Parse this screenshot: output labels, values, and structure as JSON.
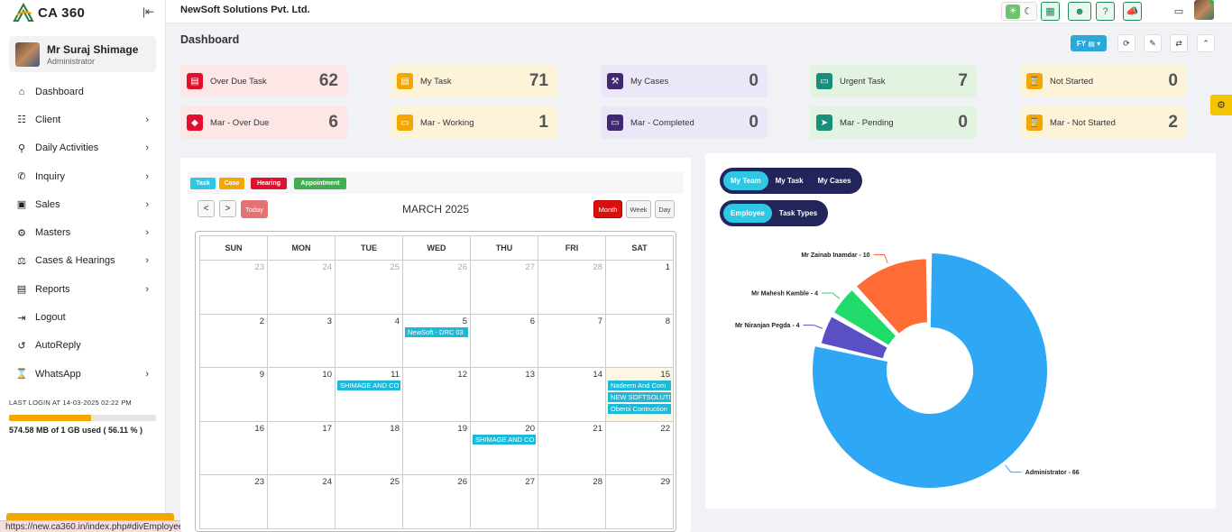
{
  "app": {
    "logo_text": "CA 360",
    "company": "NewSoft Solutions Pvt. Ltd."
  },
  "user": {
    "name": "Mr Suraj Shimage",
    "role": "Administrator"
  },
  "sidebar": {
    "items": [
      {
        "label": "Dashboard",
        "icon": "home-icon",
        "chevron": false
      },
      {
        "label": "Client",
        "icon": "users-icon",
        "chevron": true
      },
      {
        "label": "Daily Activities",
        "icon": "pin-icon",
        "chevron": true
      },
      {
        "label": "Inquiry",
        "icon": "phone-icon",
        "chevron": true
      },
      {
        "label": "Sales",
        "icon": "cash-icon",
        "chevron": true
      },
      {
        "label": "Masters",
        "icon": "gears-icon",
        "chevron": true
      },
      {
        "label": "Cases & Hearings",
        "icon": "scale-icon",
        "chevron": true
      },
      {
        "label": "Reports",
        "icon": "document-icon",
        "chevron": true
      },
      {
        "label": "Logout",
        "icon": "logout-icon",
        "chevron": false
      },
      {
        "label": "AutoReply",
        "icon": "reply-icon",
        "chevron": false
      },
      {
        "label": "WhatsApp",
        "icon": "hourglass-icon",
        "chevron": true
      }
    ],
    "last_login": "LAST LOGIN AT 14-03-2025 02:22 PM",
    "storage_text": "574.58 MB of 1 GB used ( 56.11 % )",
    "storage_pct": 56.11
  },
  "status_url": "https://new.ca360.in/index.php#divEmployee",
  "dashboard": {
    "title": "Dashboard",
    "fy_label": "FY"
  },
  "stats": [
    {
      "label": "Over Due Task",
      "value": "62",
      "bg": "#fde6e6",
      "icon_bg": "#e0102e",
      "icon": "task-icon"
    },
    {
      "label": "My Task",
      "value": "71",
      "bg": "#fdf3d8",
      "icon_bg": "#f4a700",
      "icon": "task-icon"
    },
    {
      "label": "My Cases",
      "value": "0",
      "bg": "#ece7f8",
      "icon_bg": "#3f2a72",
      "icon": "gavel-icon"
    },
    {
      "label": "Urgent Task",
      "value": "7",
      "bg": "#e3f3e2",
      "icon_bg": "#178f7a",
      "icon": "inbox-icon"
    },
    {
      "label": "Not Started",
      "value": "0",
      "bg": "#fdf3d8",
      "icon_bg": "#f4a700",
      "icon": "hourglass-icon"
    },
    {
      "label": "Mar - Over Due",
      "value": "6",
      "bg": "#fde6e6",
      "icon_bg": "#e0102e",
      "icon": "alert-icon"
    },
    {
      "label": "Mar - Working",
      "value": "1",
      "bg": "#fdf3d8",
      "icon_bg": "#f4a700",
      "icon": "inbox-icon"
    },
    {
      "label": "Mar - Completed",
      "value": "0",
      "bg": "#ece7f8",
      "icon_bg": "#3f2a72",
      "icon": "inbox-icon"
    },
    {
      "label": "Mar - Pending",
      "value": "0",
      "bg": "#e3f3e2",
      "icon_bg": "#178f7a",
      "icon": "send-icon"
    },
    {
      "label": "Mar - Not Started",
      "value": "2",
      "bg": "#fdf3d8",
      "icon_bg": "#f4a700",
      "icon": "hourglass-icon"
    }
  ],
  "calendar": {
    "legend": [
      {
        "label": "Task",
        "color": "#2ec7e6"
      },
      {
        "label": "Case",
        "color": "#f4a700"
      },
      {
        "label": "Hearing",
        "color": "#e0102e"
      },
      {
        "label": "Appointment",
        "color": "#3fae4f"
      }
    ],
    "prev_label": "<",
    "next_label": ">",
    "today_label": "Today",
    "title": "MARCH 2025",
    "views": [
      "Month",
      "Week",
      "Day"
    ],
    "weekdays": [
      "SUN",
      "MON",
      "TUE",
      "WED",
      "THU",
      "FRI",
      "SAT"
    ],
    "weeks": [
      [
        {
          "d": "23",
          "o": true
        },
        {
          "d": "24",
          "o": true
        },
        {
          "d": "25",
          "o": true
        },
        {
          "d": "26",
          "o": true
        },
        {
          "d": "27",
          "o": true
        },
        {
          "d": "28",
          "o": true
        },
        {
          "d": "1"
        }
      ],
      [
        {
          "d": "2"
        },
        {
          "d": "3"
        },
        {
          "d": "4"
        },
        {
          "d": "5",
          "ev": [
            "NewSoft - DRC 03"
          ]
        },
        {
          "d": "6"
        },
        {
          "d": "7"
        },
        {
          "d": "8"
        }
      ],
      [
        {
          "d": "9"
        },
        {
          "d": "10"
        },
        {
          "d": "11",
          "ev": [
            "SHIMAGE AND CO"
          ]
        },
        {
          "d": "12"
        },
        {
          "d": "13"
        },
        {
          "d": "14"
        },
        {
          "d": "15",
          "today": true,
          "ev": [
            "Nadeem And Com",
            "NEW SOFTSOLUTIO",
            "Oberoi Contruction"
          ]
        }
      ],
      [
        {
          "d": "16"
        },
        {
          "d": "17"
        },
        {
          "d": "18"
        },
        {
          "d": "19"
        },
        {
          "d": "20",
          "ev": [
            "SHIMAGE AND CO"
          ]
        },
        {
          "d": "21"
        },
        {
          "d": "22"
        }
      ],
      [
        {
          "d": "23"
        },
        {
          "d": "24"
        },
        {
          "d": "25"
        },
        {
          "d": "26"
        },
        {
          "d": "27"
        },
        {
          "d": "28"
        },
        {
          "d": "29"
        }
      ]
    ]
  },
  "chart_tabs": {
    "group1": [
      {
        "label": "My Team",
        "active": true
      },
      {
        "label": "My Task",
        "active": false
      },
      {
        "label": "My Cases",
        "active": false
      }
    ],
    "group2": [
      {
        "label": "Employee",
        "active": true
      },
      {
        "label": "Task Types",
        "active": false
      }
    ]
  },
  "chart_data": {
    "type": "pie",
    "donut": true,
    "slices": [
      {
        "label": "Administrator - 66",
        "value": 66,
        "color": "#2ea8f5"
      },
      {
        "label": "Mr Niranjan Pegda - 4",
        "value": 4,
        "color": "#5a4fc4"
      },
      {
        "label": "Mr Mahesh Kamble - 4",
        "value": 4,
        "color": "#1fdc6a"
      },
      {
        "label": "Mr Zainab Inamdar - 10",
        "value": 10,
        "color": "#ff6b35"
      }
    ]
  }
}
